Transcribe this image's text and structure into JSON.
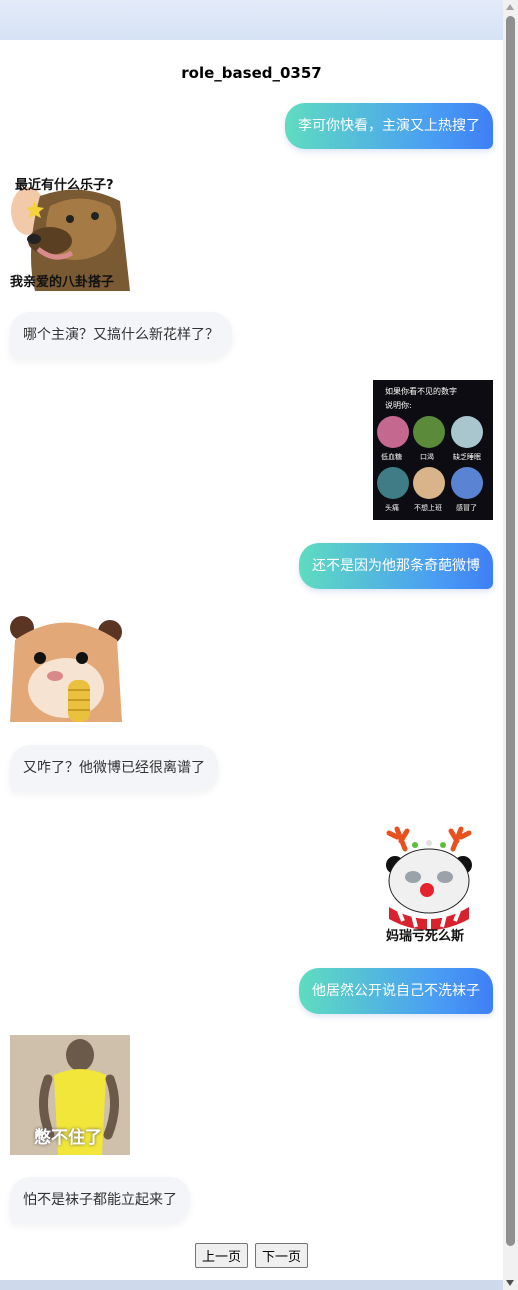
{
  "chat": {
    "title": "role_based_0357",
    "messages": [
      {
        "side": "right",
        "text": "李可你快看，主演又上热搜了"
      },
      {
        "side": "left",
        "sticker": "dog-gossip-sticker",
        "caption_top": "最近有什么乐子?",
        "caption_bottom": "我亲爱的八卦搭子"
      },
      {
        "side": "left",
        "text": "哪个主演？又搞什么新花样了？"
      },
      {
        "side": "right",
        "sticker": "color-test-sticker",
        "header": "如果你看不见的数字",
        "subheader": "说明你:",
        "labels": [
          "低血糖",
          "口渴",
          "缺乏睡眠",
          "头痛",
          "不想上班",
          "感冒了"
        ]
      },
      {
        "side": "right",
        "text": "还不是因为他那条奇葩微博"
      },
      {
        "side": "left",
        "sticker": "hamster-sticker"
      },
      {
        "side": "left",
        "text": "又咋了？他微博已经很离谱了"
      },
      {
        "side": "right",
        "sticker": "panda-reindeer-sticker",
        "caption": "妈瑞亏死么斯"
      },
      {
        "side": "right",
        "text": "他居然公开说自己不洗袜子"
      },
      {
        "side": "left",
        "sticker": "monkey-sticker",
        "caption": "憋不住了"
      },
      {
        "side": "left",
        "text": "怕不是袜子都能立起来了"
      }
    ]
  },
  "pager": {
    "prev": "上一页",
    "next": "下一页"
  },
  "colors": {
    "right_bubble_start": "#5fdcc0",
    "right_bubble_end": "#3f7ff5",
    "left_bubble": "#f3f5f9"
  }
}
